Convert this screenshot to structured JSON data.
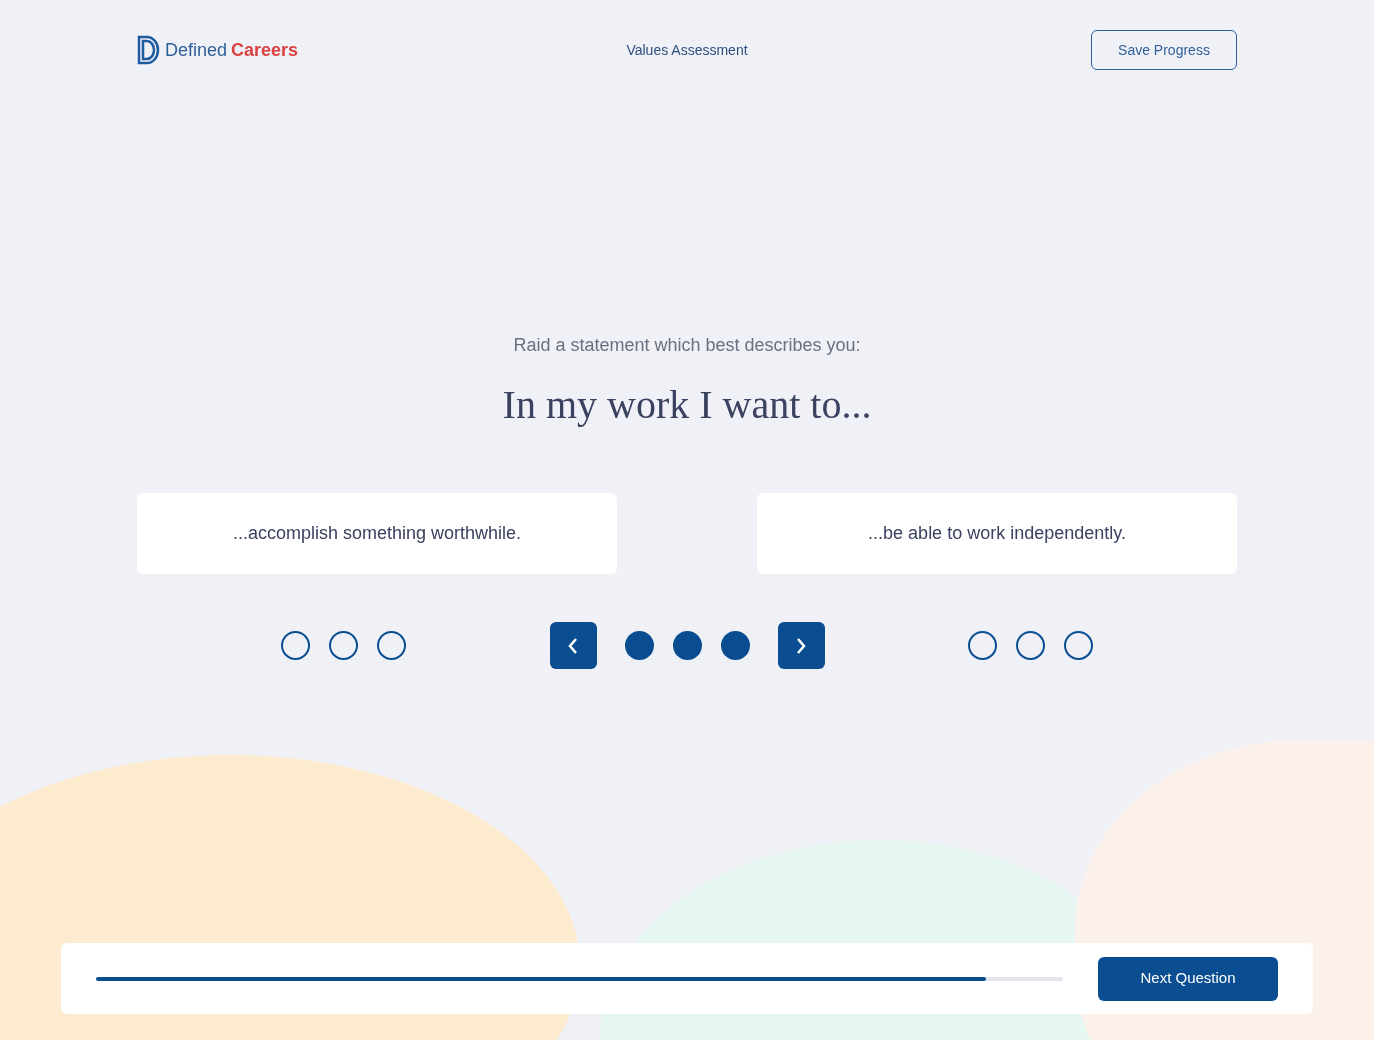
{
  "header": {
    "logo": {
      "brand_first": "Defined",
      "brand_second": "Careers"
    },
    "title": "Values Assessment",
    "save_button": "Save Progress"
  },
  "question": {
    "prompt": "Raid a statement which best describes you:",
    "heading": "In my work I want to..."
  },
  "options": [
    {
      "text": "...accomplish something worthwhile."
    },
    {
      "text": "...be able to work independently."
    }
  ],
  "scale": {
    "left_points": [
      {
        "filled": false
      },
      {
        "filled": false
      },
      {
        "filled": false
      }
    ],
    "middle_points": [
      {
        "filled": true
      },
      {
        "filled": true
      },
      {
        "filled": true
      }
    ],
    "right_points": [
      {
        "filled": false
      },
      {
        "filled": false
      },
      {
        "filled": false
      }
    ]
  },
  "footer": {
    "progress": {
      "level": 0.92
    },
    "next_button": "Next Question"
  }
}
